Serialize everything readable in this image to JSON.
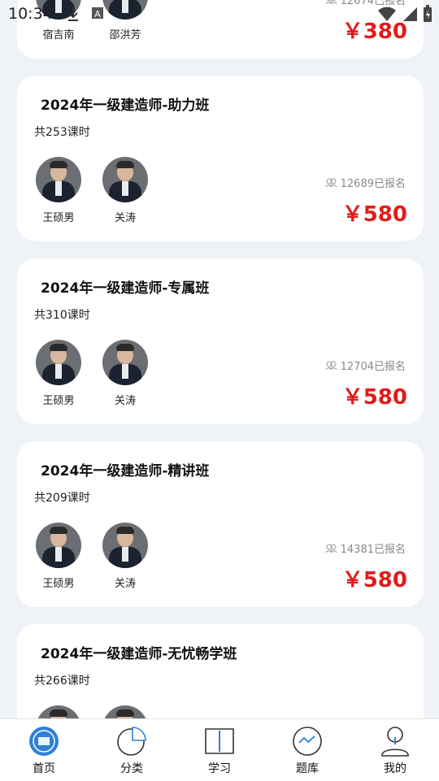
{
  "status_bar": {
    "time": "10:34"
  },
  "partial_top_card": {
    "teachers": [
      "宿吉南",
      "邵洪芳"
    ],
    "enrolled": "12674已报名",
    "price": "￥380"
  },
  "courses": [
    {
      "title": "2024年一级建造师-助力班",
      "hours": "共253课时",
      "teachers": [
        "王硕男",
        "关涛"
      ],
      "enrolled": "12689已报名",
      "price": "￥580"
    },
    {
      "title": "2024年一级建造师-专属班",
      "hours": "共310课时",
      "teachers": [
        "王硕男",
        "关涛"
      ],
      "enrolled": "12704已报名",
      "price": "￥580"
    },
    {
      "title": "2024年一级建造师-精讲班",
      "hours": "共209课时",
      "teachers": [
        "王硕男",
        "关涛"
      ],
      "enrolled": "14381已报名",
      "price": "￥580"
    },
    {
      "title": "2024年一级建造师-无忧畅学班",
      "hours": "共266课时",
      "teachers": [],
      "enrolled": "",
      "price": ""
    }
  ],
  "tabbar": [
    {
      "label": "首页",
      "icon": "home-logo-icon",
      "active": true
    },
    {
      "label": "分类",
      "icon": "pie-chart-icon",
      "active": false
    },
    {
      "label": "学习",
      "icon": "book-icon",
      "active": false
    },
    {
      "label": "题库",
      "icon": "chart-circle-icon",
      "active": false
    },
    {
      "label": "我的",
      "icon": "user-icon",
      "active": false
    }
  ],
  "colors": {
    "price": "#e21b1b",
    "accent": "#2f7fd8",
    "background": "#eff2f6"
  }
}
